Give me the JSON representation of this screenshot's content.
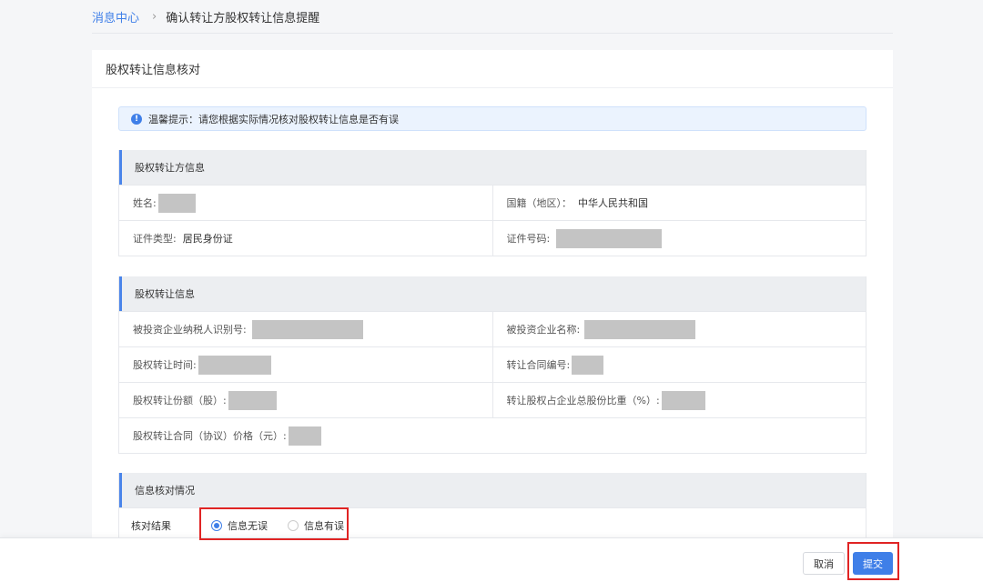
{
  "breadcrumb": {
    "root": "消息中心",
    "separator": "›",
    "current": "确认转让方股权转让信息提醒"
  },
  "card": {
    "title": "股权转让信息核对"
  },
  "tip": {
    "icon": "info-icon",
    "text": "温馨提示：请您根据实际情况核对股权转让信息是否有误"
  },
  "transferor": {
    "title": "股权转让方信息",
    "name_label": "姓名:",
    "nationality_label": "国籍（地区）：",
    "nationality_value": "中华人民共和国",
    "id_type_label": "证件类型:",
    "id_type_value": "居民身份证",
    "id_no_label": "证件号码:"
  },
  "transfer": {
    "title": "股权转让信息",
    "taxpayer_id_label": "被投资企业纳税人识别号:",
    "company_name_label": "被投资企业名称:",
    "transfer_time_label": "股权转让时间:",
    "contract_no_label": "转让合同编号:",
    "shares_label": "股权转让份额（股）:",
    "ratio_label": "转让股权占企业总股份比重（%）:",
    "price_label": "股权转让合同（协议）价格（元）:"
  },
  "verification": {
    "title": "信息核对情况",
    "result_label": "核对结果",
    "options": [
      "信息无误",
      "信息有误"
    ],
    "selected": "信息无误"
  },
  "footer": {
    "cancel_label": "取消",
    "submit_label": "提交"
  },
  "colors": {
    "accent": "#3f7fe8",
    "highlight": "#e02424"
  }
}
